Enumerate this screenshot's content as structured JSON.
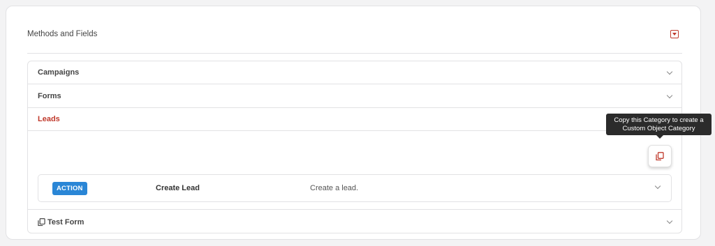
{
  "header": {
    "title": "Methods and Fields",
    "collapse_icon": "collapse-icon"
  },
  "accordion": {
    "items": [
      {
        "label": "Campaigns",
        "state": "collapsed"
      },
      {
        "label": "Forms",
        "state": "collapsed"
      },
      {
        "label": "Leads",
        "state": "expanded"
      },
      {
        "label": "Test Form",
        "state": "collapsed",
        "icon": "copy-icon"
      }
    ]
  },
  "leads": {
    "copy_tooltip_line1": "Copy this Category to create a",
    "copy_tooltip_line2": "Custom Object Category",
    "methods": [
      {
        "badge": "ACTION",
        "name": "Create Lead",
        "description": "Create a lead."
      }
    ]
  },
  "colors": {
    "accent": "#c0392b",
    "badge": "#2a86d6",
    "tooltip_bg": "#2b2b2b"
  }
}
